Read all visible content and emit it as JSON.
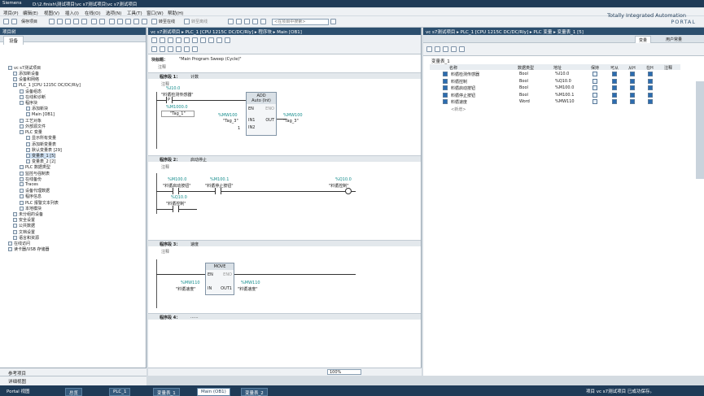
{
  "titlebar": {
    "app": "Siemens",
    "path": "D:\\2.finish\\测试项目\\vc s7测试项目\\vc s7测试项目"
  },
  "menu": [
    "项目(P)",
    "编辑(E)",
    "视图(V)",
    "插入(I)",
    "在线(O)",
    "选项(N)",
    "工具(T)",
    "窗口(W)",
    "帮助(H)"
  ],
  "toolbar": {
    "save_label": "保存项目",
    "online_label": "转至在线",
    "offline_label": "转至离线",
    "search_placeholder": "<在项目中搜索>"
  },
  "brand": {
    "line1": "Totally Integrated Automation",
    "line2": "PORTAL"
  },
  "tree": {
    "panel_title": "项目树",
    "tab": "设备",
    "items": [
      "vc s7测试项目",
      "添加新设备",
      "设备和网络",
      "PLC_1 [CPU 1215C DC/DC/Rly]",
      "设备组态",
      "在线和诊断",
      "程序块",
      "添加新块",
      "Main [OB1]",
      "工艺对象",
      "外部源文件",
      "PLC 变量",
      "显示所有变量",
      "添加新变量表",
      "默认变量表 [29]",
      "变量表_1 [5]",
      "变量表_2 [2]",
      "PLC 数据类型",
      "监控与强制表",
      "在线备份",
      "Traces",
      "设备代理数据",
      "程序信息",
      "PLC 报警文本列表",
      "本地模块",
      "未分组的设备",
      "安全设置",
      "公共数据",
      "文档设置",
      "语言和资源",
      "在线访问",
      "读卡器/USB 存储器"
    ],
    "bottom": [
      "参考项目",
      "详细视图"
    ]
  },
  "editor": {
    "breadcrumb": "vc s7测试项目 ▸ PLC_1 [CPU 1215C DC/DC/Rly] ▸ 程序块 ▸ Main [OB1]",
    "block_title_label": "块标题：",
    "block_title": "\"Main Program Sweep (Cycle)\"",
    "comment": "注释",
    "networks": [
      {
        "label": "程序段 1：",
        "title": "计数",
        "comment": "注释"
      },
      {
        "label": "程序段 2：",
        "title": "启动停止",
        "comment": "注释"
      },
      {
        "label": "程序段 3：",
        "title": "速度",
        "comment": "注释"
      },
      {
        "label": "程序段 4：",
        "title": "......",
        "comment": ""
      }
    ],
    "n1": {
      "contact_addr": "%I10.0",
      "contact_name": "\"料循检测传感器\"",
      "p": "P",
      "p_addr": "%M1000.0",
      "p_name": "\"Tag_1\"",
      "box": "ADD",
      "box_sub": "Auto (Int)",
      "en": "EN",
      "eno": "ENO",
      "in1_addr": "%MW100",
      "in1_name": "\"Tag_3\"",
      "in1": "IN1",
      "in2": "IN2",
      "in2_val": "1",
      "out": "OUT",
      "out_addr": "%MW100",
      "out_name": "\"Tag_3\""
    },
    "n2": {
      "c1_addr": "%M100.0",
      "c1_name": "\"料循启动按钮\"",
      "c2_addr": "%M100.1",
      "c2_name": "\"料循停止按钮\"",
      "coil_addr": "%Q10.0",
      "coil_name": "\"料循控制\"",
      "c3_addr": "%Q10.0",
      "c3_name": "\"料循控制\""
    },
    "n3": {
      "box": "MOVE",
      "en": "EN",
      "eno": "ENO",
      "in_addr": "%MW110",
      "in_name": "\"料循速度\"",
      "in": "IN",
      "out": "OUT1",
      "out_addr": "%MW110",
      "out_name": "\"料循速度\""
    },
    "zoom": "100%"
  },
  "tags": {
    "breadcrumb": "vc s7测试项目 ▸ PLC_1 [CPU 1215C DC/DC/Rly] ▸ PLC 变量 ▸ 变量表_1 [5]",
    "tab_vars": "变量",
    "tab_user": "用户常量",
    "table_title": "变量表_1",
    "headers": [
      "名称",
      "数据类型",
      "地址",
      "保持",
      "可从",
      "从H",
      "在H",
      "注释"
    ],
    "rows": [
      {
        "name": "料循检测传感器",
        "type": "Bool",
        "addr": "%I10.0"
      },
      {
        "name": "料循控制",
        "type": "Bool",
        "addr": "%Q10.0"
      },
      {
        "name": "料循启动按钮",
        "type": "Bool",
        "addr": "%M100.0"
      },
      {
        "name": "料循停止按钮",
        "type": "Bool",
        "addr": "%M100.1"
      },
      {
        "name": "料循速度",
        "type": "Word",
        "addr": "%MW110"
      }
    ],
    "add_new": "<新增>"
  },
  "status": {
    "portal": "Portal 视图",
    "tabs": [
      "总览",
      "PLC_1",
      "变量表_1",
      "Main (OB1)",
      "变量表_2"
    ],
    "msg": "项目 vc s7测试项目 已成功保存。"
  }
}
